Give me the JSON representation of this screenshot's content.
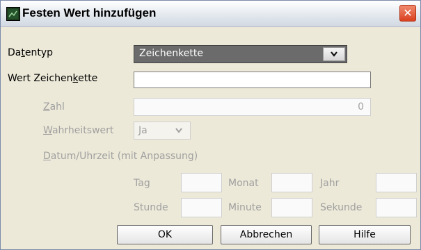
{
  "window": {
    "title": "Festen Wert hinzufügen",
    "close_glyph": "✕"
  },
  "form": {
    "datentyp_label_pre": "Da",
    "datentyp_label_u": "t",
    "datentyp_label_post": "entyp",
    "datentyp_value": "Zeichenkette",
    "wert_label_pre": "Wert Zeichen",
    "wert_label_u": "k",
    "wert_label_post": "ette",
    "wert_value": "",
    "zahl_label_u": "Z",
    "zahl_label_post": "ahl",
    "zahl_value": "0",
    "wahrheit_label_u": "W",
    "wahrheit_label_post": "ahrheitswert",
    "wahrheit_value": "Ja",
    "datum_label_u": "D",
    "datum_label_post": "atum/Uhrzeit (mit Anpassung)",
    "tag_label": "Tag",
    "monat_label": "Monat",
    "jahr_label": "Jahr",
    "stunde_label": "Stunde",
    "minute_label": "Minute",
    "sekunde_label": "Sekunde"
  },
  "buttons": {
    "ok": "OK",
    "cancel": "Abbrechen",
    "help": "Hilfe"
  },
  "icons": {
    "chevron": "⌄"
  }
}
